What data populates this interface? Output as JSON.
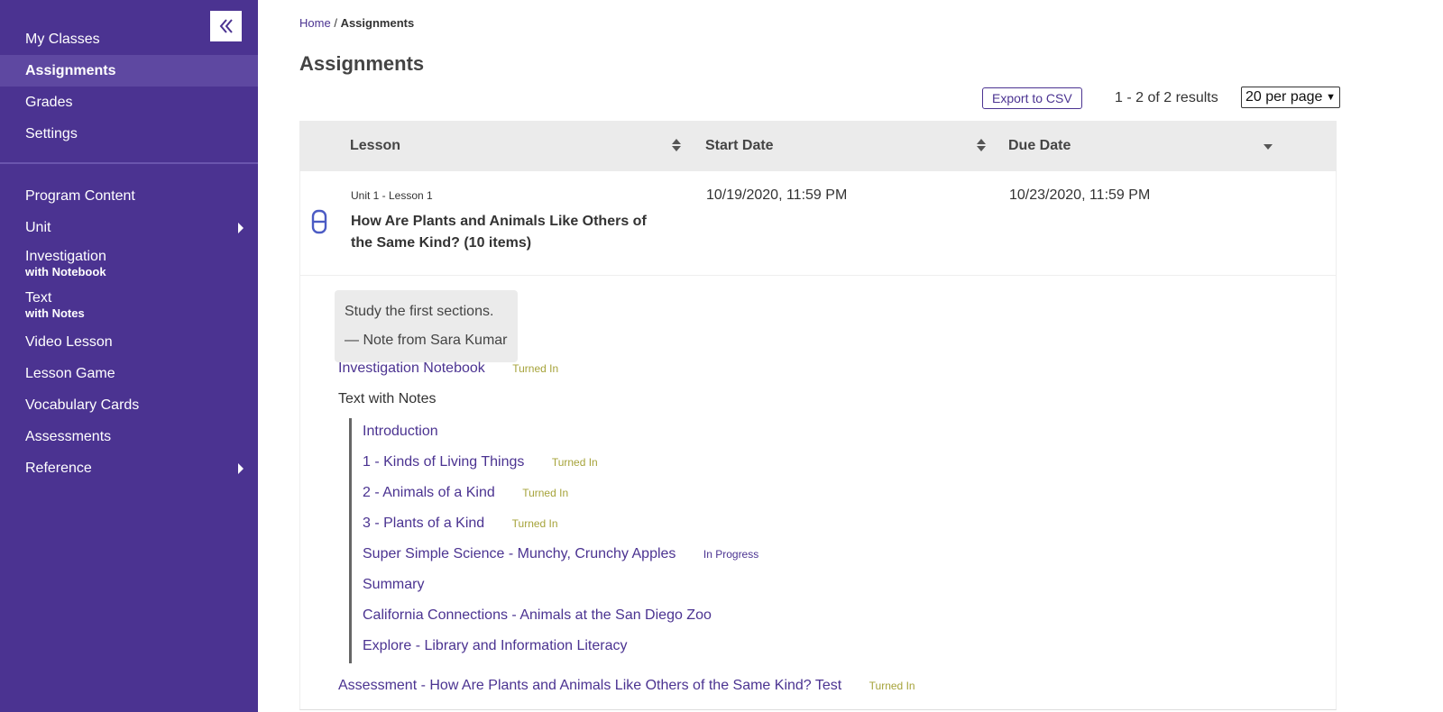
{
  "sidebar": {
    "primary": [
      {
        "label": "My Classes",
        "active": false
      },
      {
        "label": "Assignments",
        "active": true
      },
      {
        "label": "Grades",
        "active": false
      },
      {
        "label": "Settings",
        "active": false
      }
    ],
    "program": {
      "program_content": "Program Content",
      "unit": "Unit",
      "investigation": "Investigation",
      "investigation_sub": "with Notebook",
      "text": "Text",
      "text_sub": "with Notes",
      "video_lesson": "Video Lesson",
      "lesson_game": "Lesson Game",
      "vocabulary_cards": "Vocabulary Cards",
      "assessments": "Assessments",
      "reference": "Reference"
    }
  },
  "breadcrumb": {
    "home": "Home",
    "separator": "/",
    "current": "Assignments"
  },
  "page": {
    "title": "Assignments"
  },
  "toolbar": {
    "export_label": "Export to CSV",
    "results": "1 - 2 of 2 results",
    "per_page": "20 per page"
  },
  "table": {
    "headers": {
      "lesson": "Lesson",
      "start_date": "Start Date",
      "due_date": "Due Date"
    },
    "rows": [
      {
        "unit": "Unit 1 - Lesson 1",
        "title": "How Are Plants and Animals Like Others of the Same Kind? (10 items)",
        "start_date": "10/19/2020, 11:59 PM",
        "due_date": "10/23/2020, 11:59 PM"
      }
    ]
  },
  "details": {
    "note_text": "Study the first sections.",
    "note_from": "— Note from Sara Kumar",
    "investigation_link": "Investigation Notebook",
    "investigation_status": "Turned In",
    "text_heading": "Text with Notes",
    "sections": [
      {
        "label": "Introduction",
        "status": ""
      },
      {
        "label": "1 - Kinds of Living Things",
        "status": "Turned In"
      },
      {
        "label": "2 - Animals of a Kind",
        "status": "Turned In"
      },
      {
        "label": "3 - Plants of a Kind",
        "status": "Turned In"
      },
      {
        "label": "Super Simple Science - Munchy, Crunchy Apples",
        "status": "In Progress"
      },
      {
        "label": "Summary",
        "status": ""
      },
      {
        "label": "California Connections - Animals at the San Diego Zoo",
        "status": ""
      },
      {
        "label": "Explore - Library and Information Literacy",
        "status": ""
      }
    ],
    "assessment_link": "Assessment - How Are Plants and Animals Like Others of the Same Kind? Test",
    "assessment_status": "Turned In"
  },
  "colors": {
    "sidebar_bg": "#4b3391",
    "sidebar_active": "#5e48a1",
    "link": "#4b3391",
    "turned_in": "#a6a33a",
    "header_bg": "#ebebeb"
  }
}
